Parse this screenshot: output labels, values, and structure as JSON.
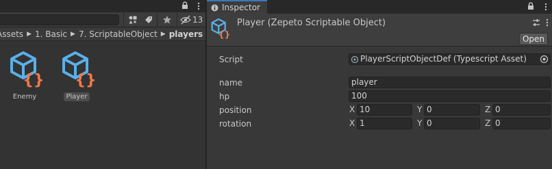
{
  "project": {
    "hidden_count": "13",
    "breadcrumb": [
      "Assets",
      "1. Basic",
      "7. ScriptableObject",
      "players"
    ],
    "assets": [
      {
        "label": "Enemy",
        "selected": false
      },
      {
        "label": "Player",
        "selected": true
      }
    ]
  },
  "inspector": {
    "tab_label": "Inspector",
    "title": "Player (Zepeto Scriptable Object)",
    "open_label": "Open",
    "script": {
      "label": "Script",
      "value": "PlayerScriptObjectDef (Typescript Asset)"
    },
    "fields": {
      "name": {
        "label": "name",
        "value": "player"
      },
      "hp": {
        "label": "hp",
        "value": "100"
      },
      "position": {
        "label": "position",
        "x": "10",
        "y": "0",
        "z": "0"
      },
      "rotation": {
        "label": "rotation",
        "x": "1",
        "y": "0",
        "z": "0"
      }
    },
    "axis_labels": {
      "x": "X",
      "y": "Y",
      "z": "Z"
    }
  },
  "colors": {
    "icon_blue": "#5ab0ea",
    "icon_orange": "#f0794a",
    "tab_accent": "#3a79bb"
  }
}
